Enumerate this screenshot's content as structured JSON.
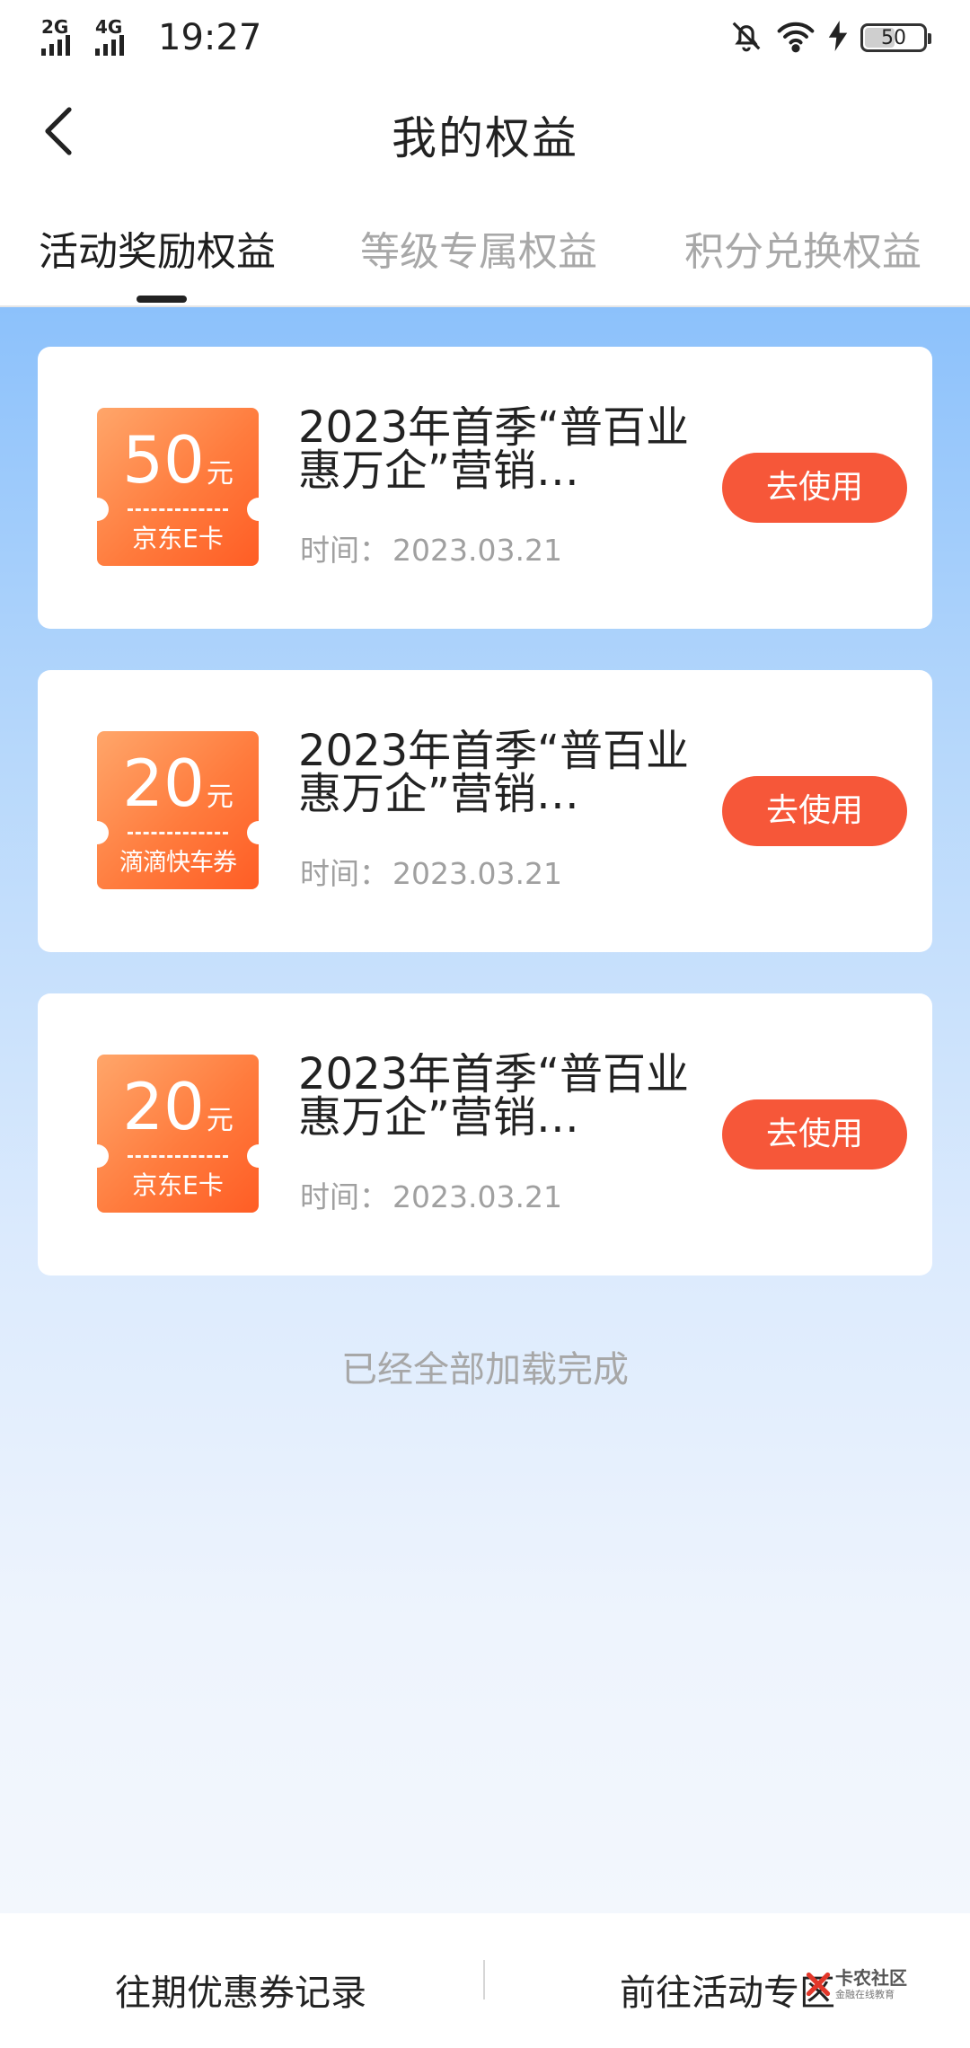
{
  "status_bar": {
    "net1": "2G",
    "net2": "4G",
    "time": "19:27",
    "battery": "50",
    "battery_level": 0.5
  },
  "header": {
    "title": "我的权益"
  },
  "tabs": [
    {
      "label": "活动奖励权益",
      "active": true
    },
    {
      "label": "等级专属权益",
      "active": false
    },
    {
      "label": "积分兑换权益",
      "active": false
    }
  ],
  "items": [
    {
      "amount": "50",
      "unit": "元",
      "type": "京东E卡",
      "title": "2023年首季“普百业 惠万企”营销…",
      "time_label": "时间：",
      "time": "2023.03.21",
      "button": "去使用"
    },
    {
      "amount": "20",
      "unit": "元",
      "type": "滴滴快车券",
      "title": "2023年首季“普百业 惠万企”营销…",
      "time_label": "时间：",
      "time": "2023.03.21",
      "button": "去使用"
    },
    {
      "amount": "20",
      "unit": "元",
      "type": "京东E卡",
      "title": "2023年首季“普百业 惠万企”营销…",
      "time_label": "时间：",
      "time": "2023.03.21",
      "button": "去使用"
    }
  ],
  "list_footer": "已经全部加载完成",
  "bottom": {
    "left": "往期优惠券记录",
    "right": "前往活动专区"
  },
  "watermark": {
    "main": "卡农社区",
    "sub": "金融在线教育"
  },
  "colors": {
    "accent": "#f65739",
    "coupon": "#ff7b3d",
    "gradient_top": "#8cc1fb"
  },
  "icons": {
    "back": "chevron-left-icon",
    "mute": "bell-off-icon",
    "wifi": "wifi-icon",
    "charge": "bolt-icon"
  }
}
